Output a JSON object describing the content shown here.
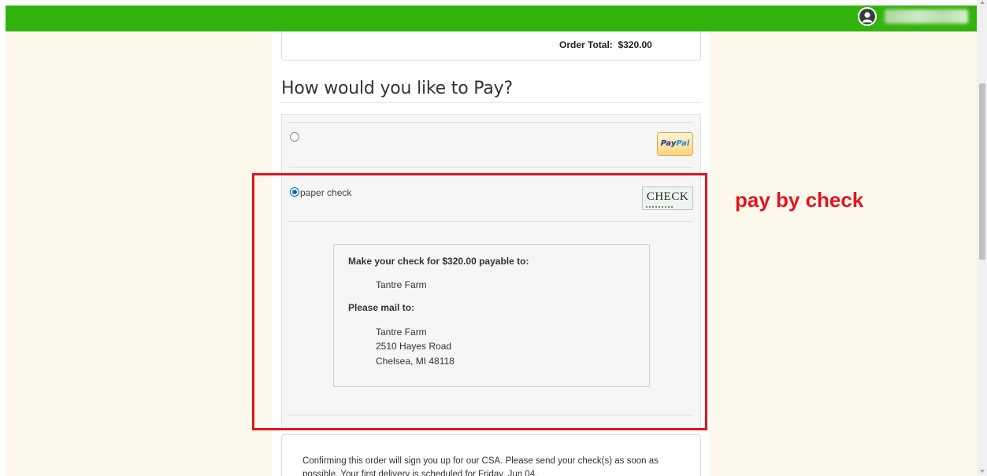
{
  "order": {
    "total_label": "Order Total:",
    "total_value": "$320.00"
  },
  "payment": {
    "heading": "How would you like to Pay?",
    "methods": [
      {
        "label": "",
        "badge": "PayPal",
        "badge_part1": "Pay",
        "badge_part2": "Pal",
        "selected": false
      },
      {
        "label": "paper check",
        "badge": "CHECK",
        "selected": true
      }
    ]
  },
  "check_instructions": {
    "make_payable": "Make your check for $320.00 payable to:",
    "payee": "Tantre Farm",
    "mail_to": "Please mail to:",
    "address_line1": "Tantre Farm",
    "address_line2": "2510 Hayes Road",
    "address_line3": "Chelsea, MI 48118"
  },
  "annotation": {
    "text": "pay by check",
    "color": "#e3141c"
  },
  "confirmation": {
    "text": "Confirming this order will sign you up for our CSA. Please send your check(s) as soon as possible. Your first delivery is scheduled for Friday, Jun 04."
  },
  "colors": {
    "topbar": "#33b30d",
    "page_background": "#fdf8ec",
    "radio_selected": "#0b62d6"
  },
  "icons": {
    "user": "user-avatar-icon",
    "paypal": "paypal-logo-icon",
    "check": "check-image-icon"
  }
}
